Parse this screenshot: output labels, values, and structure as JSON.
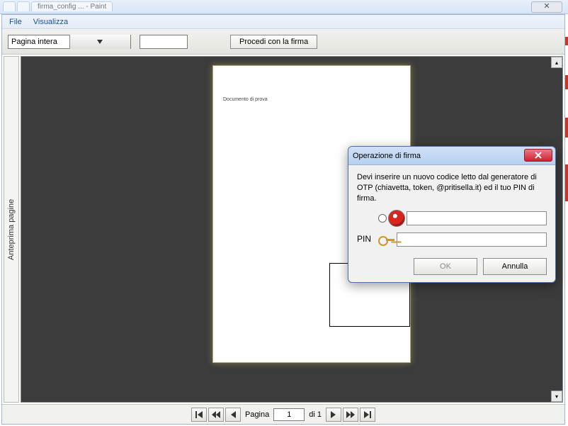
{
  "chrome": {
    "close_glyph": "✕",
    "tab1": "",
    "tab2": "",
    "tab3_hint": "firma_config ... - Paint"
  },
  "menu": {
    "file": "File",
    "view": "Visualizza"
  },
  "toolbar": {
    "zoom_selected": "Pagina intera",
    "proceed_label": "Procedi con la firma",
    "text_value": ""
  },
  "side_tab_label": "Anteprima pagine",
  "document": {
    "sample_text": "Documento di prova"
  },
  "pager": {
    "label_prefix": "Pagina",
    "current": "1",
    "label_suffix": "di 1"
  },
  "dialog": {
    "title": "Operazione di firma",
    "message": "Devi inserire un nuovo codice letto dal generatore di OTP (chiavetta, token, @pritisella.it) ed il tuo PIN di firma.",
    "pin_label": "PIN",
    "otp_value": "",
    "pin_value": "",
    "ok_label": "OK",
    "cancel_label": "Annulla"
  }
}
